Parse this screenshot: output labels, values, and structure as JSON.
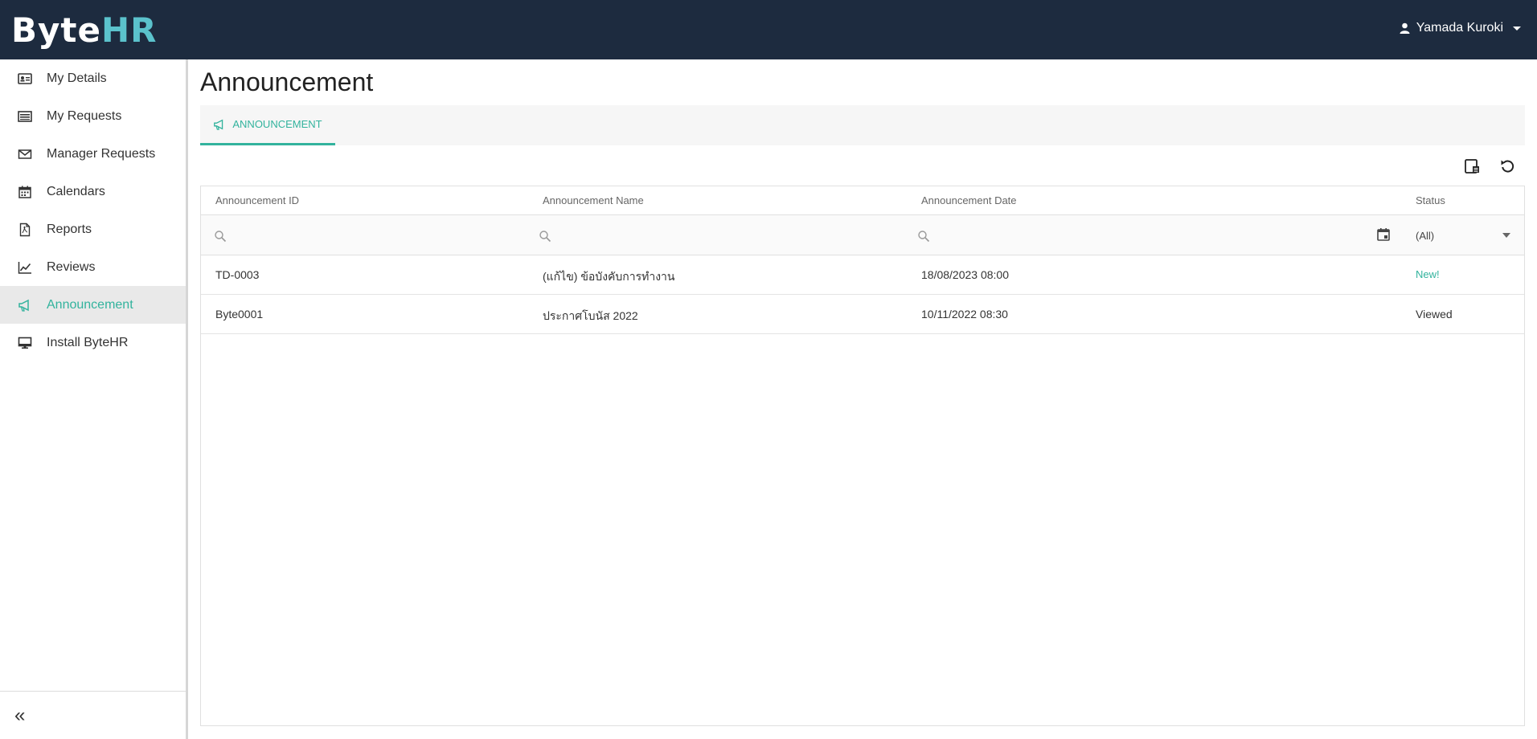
{
  "app": {
    "logo_left": "By",
    "logo_mid": "te",
    "logo_right": "HR",
    "user_name": "Yamada Kuroki"
  },
  "sidebar": {
    "items": [
      {
        "label": "My Details",
        "icon": "id-card-icon"
      },
      {
        "label": "My Requests",
        "icon": "list-icon"
      },
      {
        "label": "Manager Requests",
        "icon": "envelope-icon"
      },
      {
        "label": "Calendars",
        "icon": "calendar-icon"
      },
      {
        "label": "Reports",
        "icon": "pdf-file-icon"
      },
      {
        "label": "Reviews",
        "icon": "line-chart-icon"
      },
      {
        "label": "Announcement",
        "icon": "megaphone-icon",
        "active": true
      },
      {
        "label": "Install ByteHR",
        "icon": "monitor-icon"
      }
    ],
    "collapse_label": "«"
  },
  "page": {
    "title": "Announcement",
    "tab_label": "ANNOUNCEMENT"
  },
  "grid": {
    "columns": [
      "Announcement ID",
      "Announcement Name",
      "Announcement Date",
      "Status"
    ],
    "status_filter": "(All)",
    "rows": [
      {
        "id": "TD-0003",
        "name": "(แก้ไข) ข้อบังคับการทำงาน",
        "date": "18/08/2023 08:00",
        "status": "New!"
      },
      {
        "id": "Byte0001",
        "name": "ประกาศโบนัส 2022",
        "date": "10/11/2022 08:30",
        "status": "Viewed"
      }
    ]
  },
  "colors": {
    "header_bg": "#1d2b3f",
    "accent": "#32b39d",
    "logo_accent": "#5bc2cc"
  }
}
